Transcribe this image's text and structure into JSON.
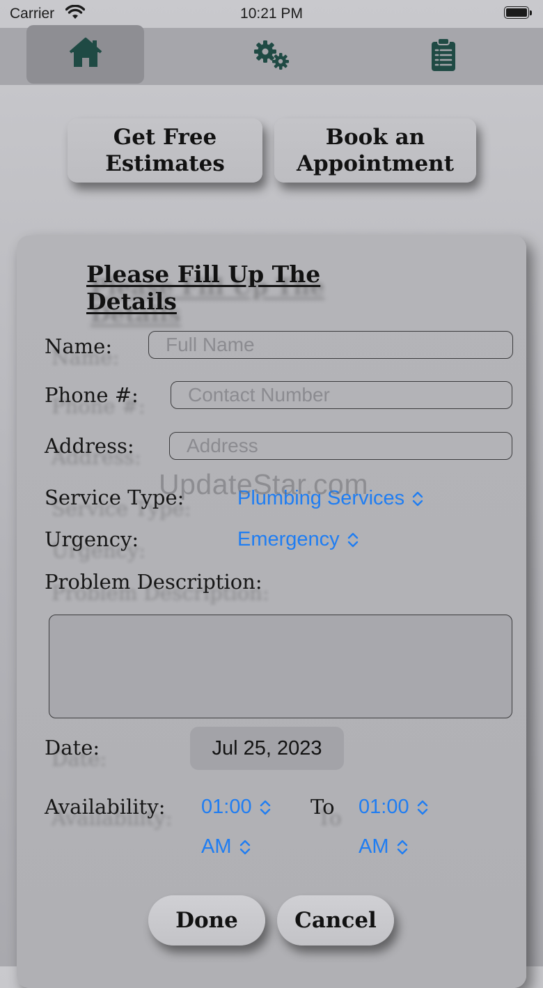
{
  "status_bar": {
    "carrier": "Carrier",
    "time": "10:21 PM"
  },
  "nav": {
    "tabs": [
      {
        "icon": "home-icon",
        "selected": true
      },
      {
        "icon": "gears-icon",
        "selected": false
      },
      {
        "icon": "clipboard-icon",
        "selected": false
      }
    ],
    "accent_color": "#1f4a44"
  },
  "top_buttons": {
    "estimates_label": "Get Free Estimates",
    "appointment_label": "Book an Appointment"
  },
  "form": {
    "title": "Please Fill Up The Details",
    "name": {
      "label": "Name:",
      "placeholder": "Full Name",
      "value": ""
    },
    "phone": {
      "label": "Phone #:",
      "placeholder": "Contact Number",
      "value": ""
    },
    "address": {
      "label": "Address:",
      "placeholder": "Address",
      "value": ""
    },
    "service_type": {
      "label": "Service Type:",
      "value": "Plumbing Services"
    },
    "urgency": {
      "label": "Urgency:",
      "value": "Emergency"
    },
    "problem": {
      "label": "Problem Description:",
      "value": ""
    },
    "date": {
      "label": "Date:",
      "value": "Jul 25, 2023"
    },
    "availability": {
      "label": "Availability:",
      "from_time": "01:00",
      "from_period": "AM",
      "to_label": "To",
      "to_time": "01:00",
      "to_period": "AM"
    },
    "picker_color": "#1f7df2"
  },
  "watermark": "UpdateStar.com",
  "actions": {
    "done_label": "Done",
    "cancel_label": "Cancel"
  }
}
